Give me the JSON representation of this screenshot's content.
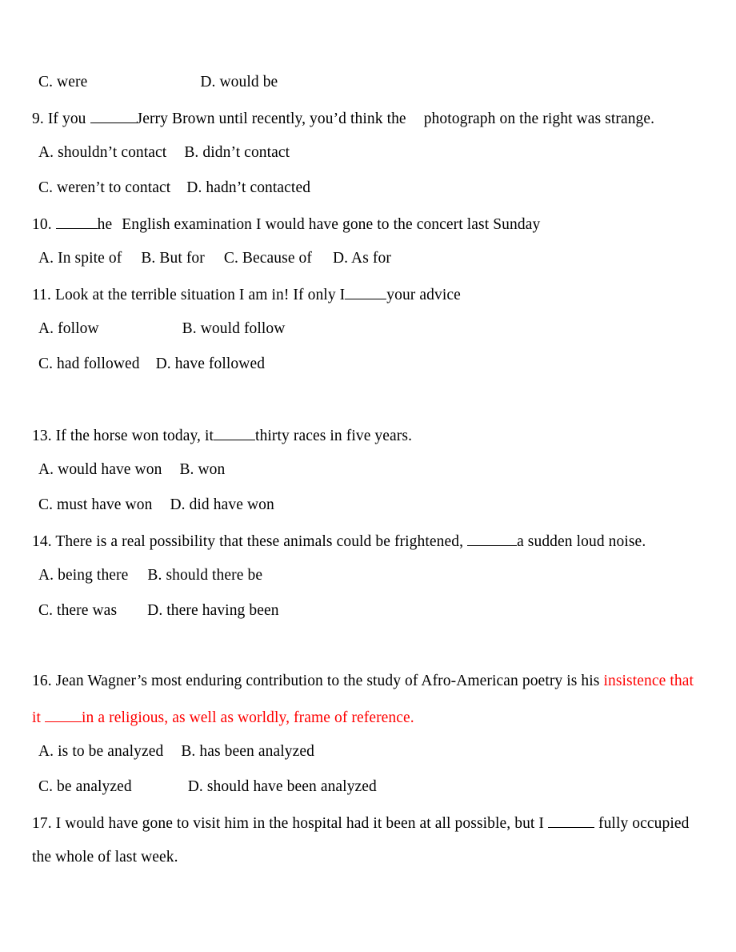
{
  "document": {
    "type": "english-grammar-multiple-choice-worksheet",
    "page_background": "#ffffff",
    "text_color": "#000000",
    "highlight_color": "#ff0000"
  },
  "lines": {
    "q8_options_cd": {
      "option_c": "C. were",
      "option_d": "D. would be"
    },
    "q9": {
      "number": "9.",
      "stem_before_blank": "If you",
      "stem_after_blank": "Jerry Brown until recently, you’d think the",
      "stem_tail": "photograph on the right was strange.",
      "option_a": "A. shouldn’t contact",
      "option_b": "B. didn’t contact",
      "option_c": "C. weren’t to contact",
      "option_d": "D. hadn’t contacted"
    },
    "q10": {
      "number": "10.",
      "stem_after_blank": "he",
      "stem_tail": "English examination I would have gone to the concert last Sunday",
      "option_a": "A. In spite of",
      "option_b": "B. But for",
      "option_c": "C. Because of",
      "option_d": "D. As for"
    },
    "q11": {
      "number": "11.",
      "stem_before_blank": "Look at the terrible situation I am in! If only I",
      "stem_after_blank": "your advice",
      "option_a": "A. follow",
      "option_b": "B. would follow",
      "option_c": "C. had followed",
      "option_d": "D. have followed"
    },
    "q13": {
      "number": "13.",
      "stem_before_blank": "If the horse won today, it",
      "stem_after_blank": "thirty races in five years.",
      "option_a": "A. would have won",
      "option_b": "B. won",
      "option_c": "C. must have won",
      "option_d": "D. did have won"
    },
    "q14": {
      "number": "14.",
      "stem_before_blank": "There is a real possibility that these animals could be frightened,",
      "stem_after_blank": "a sudden loud noise.",
      "option_a": "A. being there",
      "option_b": "B. should there be",
      "option_c": "C. there was",
      "option_d": "D. there having been"
    },
    "q16": {
      "number": "16.",
      "stem_black": "Jean Wagner’s most enduring contribution to the study of Afro-American poetry is his",
      "stem_red_line1": "insistence that",
      "stem_red_line2_before_blank": "it",
      "stem_red_line2_after_blank": "in a religious, as well as worldly, frame of reference.",
      "option_a": "A. is to be analyzed",
      "option_b": "B. has been analyzed",
      "option_c": "C. be analyzed",
      "option_d": "D. should have been analyzed"
    },
    "q17": {
      "number": "17.",
      "stem_before_blank": "I would have gone to visit him in the hospital had it been at all possible, but I",
      "stem_after_blank": "fully occupied",
      "stem_line2": "the whole of last week."
    }
  }
}
